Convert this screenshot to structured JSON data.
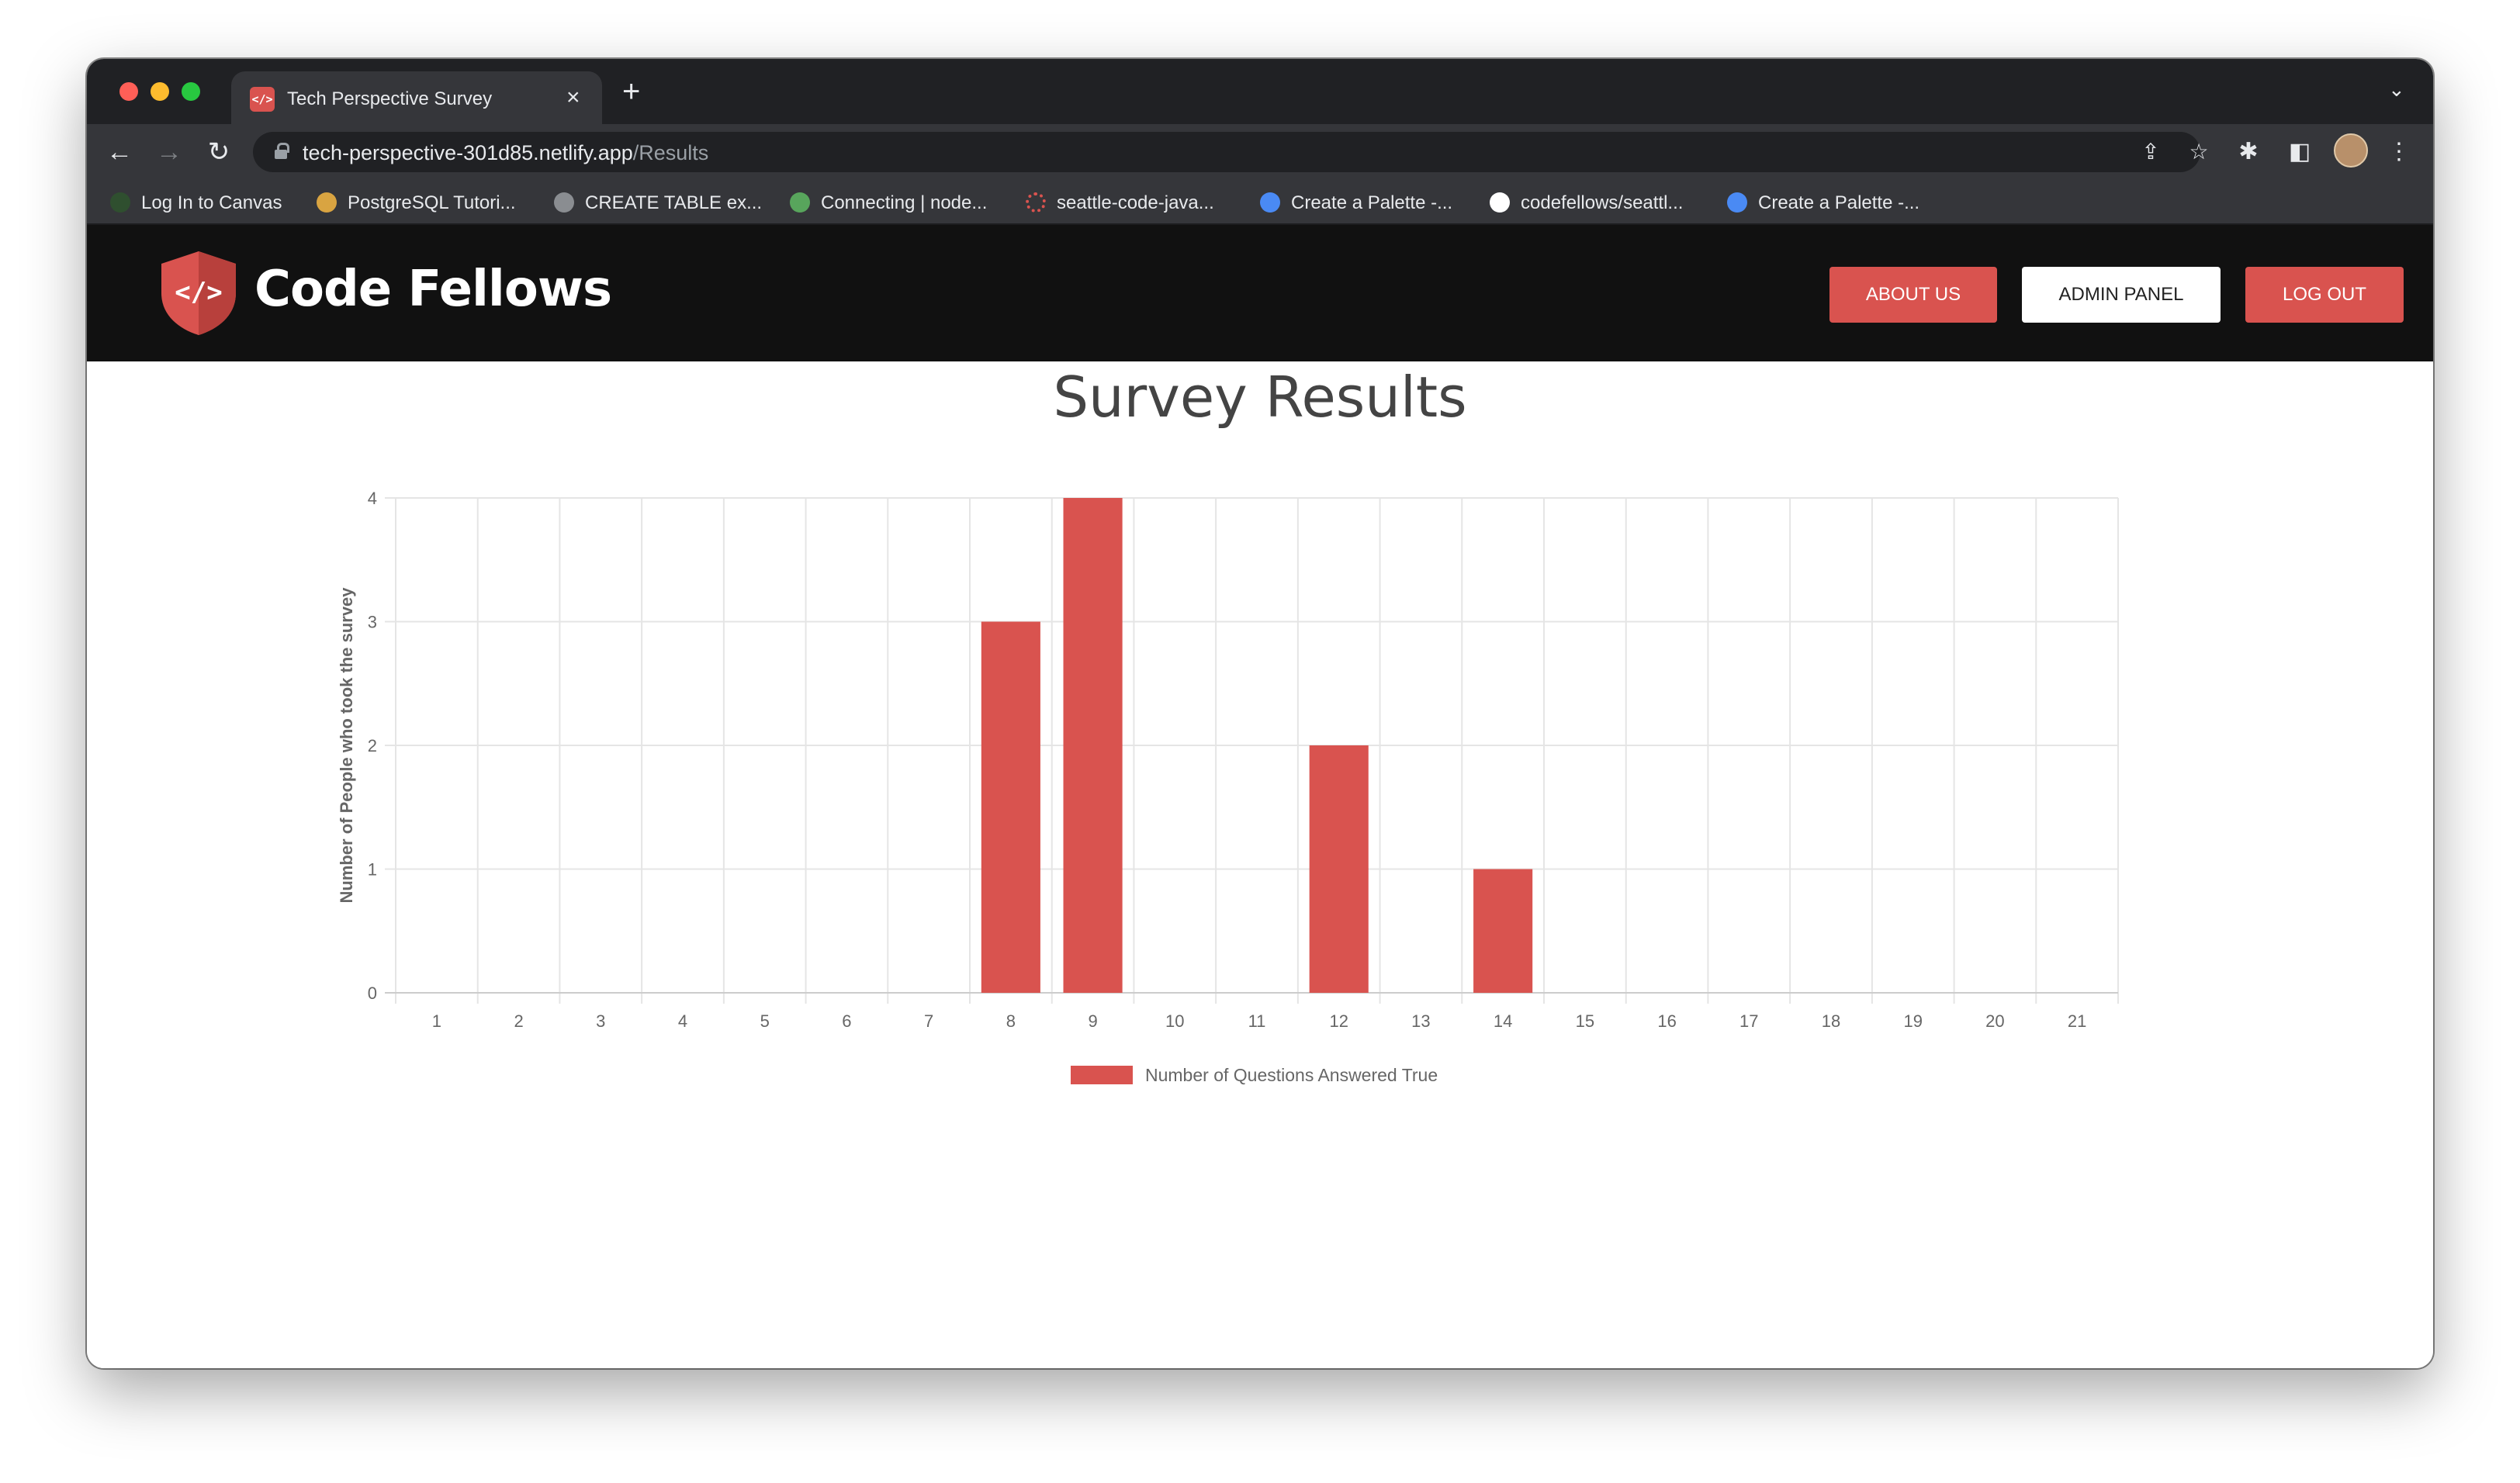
{
  "browser": {
    "tab_title": "Tech Perspective Survey",
    "tab_favicon_text": "</>",
    "url_host": "tech-perspective-301d85.netlify.app",
    "url_path": "/Results",
    "bookmarks": [
      {
        "label": "Log In to Canvas",
        "icon": "canvas-icon",
        "color": "#2f4f2f"
      },
      {
        "label": "PostgreSQL Tutori...",
        "icon": "postgresql-icon",
        "color": "#d9a441"
      },
      {
        "label": "CREATE TABLE ex...",
        "icon": "globe-icon",
        "color": "#8a8d91"
      },
      {
        "label": "Connecting | node...",
        "icon": "elephant-icon",
        "color": "#58a55c"
      },
      {
        "label": "seattle-code-java...",
        "icon": "spinner-icon",
        "color": "#d9534f"
      },
      {
        "label": "Create a Palette -...",
        "icon": "palette-icon",
        "color": "#4a8af4"
      },
      {
        "label": "codefellows/seattl...",
        "icon": "github-icon",
        "color": "#ffffff"
      },
      {
        "label": "Create a Palette -...",
        "icon": "palette-icon",
        "color": "#4a8af4"
      }
    ]
  },
  "header": {
    "logo_text": "Code Fellows",
    "logo_mark": "</>",
    "nav": {
      "about": "ABOUT US",
      "admin": "ADMIN PANEL",
      "logout": "LOG OUT"
    }
  },
  "colors": {
    "accent": "#d9534f",
    "header_bg": "#111111"
  },
  "page": {
    "title": "Survey Results"
  },
  "chart_data": {
    "type": "bar",
    "categories": [
      "1",
      "2",
      "3",
      "4",
      "5",
      "6",
      "7",
      "8",
      "9",
      "10",
      "11",
      "12",
      "13",
      "14",
      "15",
      "16",
      "17",
      "18",
      "19",
      "20",
      "21"
    ],
    "series": [
      {
        "name": "Number of Questions Answered True",
        "values": [
          0,
          0,
          0,
          0,
          0,
          0,
          0,
          3,
          4,
          0,
          0,
          2,
          0,
          1,
          0,
          0,
          0,
          0,
          0,
          0,
          0
        ],
        "color": "#d9534f"
      }
    ],
    "xlabel": "",
    "ylabel": "Number of People who took the survey",
    "ylim": [
      0,
      4
    ],
    "yticks": [
      0,
      1,
      2,
      3,
      4
    ],
    "grid": true,
    "legend": "bottom"
  }
}
